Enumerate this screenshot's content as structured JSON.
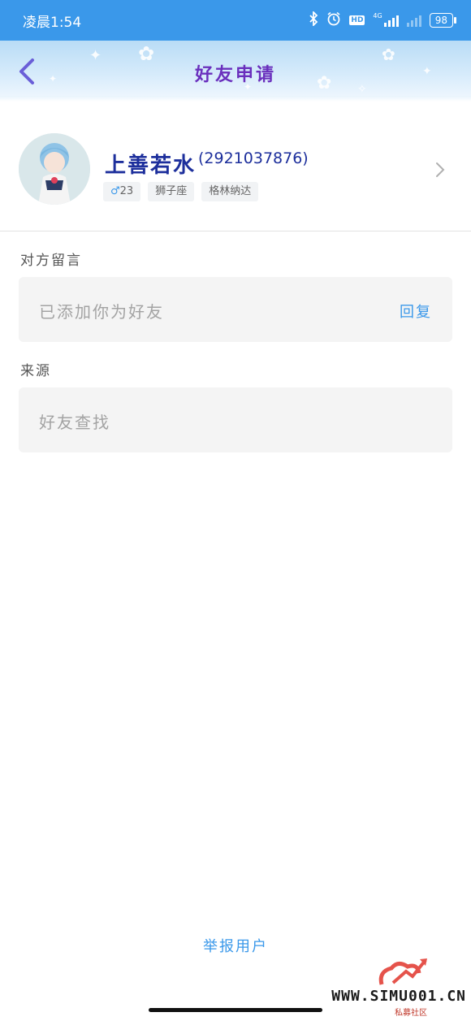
{
  "status_bar": {
    "time": "凌晨1:54",
    "hd": "HD",
    "network": "4G",
    "battery": "98"
  },
  "header": {
    "title": "好友申请"
  },
  "profile": {
    "nickname": "上善若水",
    "qq": "(2921037876)",
    "tags": {
      "gender_symbol": "♂",
      "age": "23",
      "zodiac": "狮子座",
      "location": "格林纳达"
    }
  },
  "message_section": {
    "label": "对方留言",
    "text": "已添加你为好友",
    "reply": "回复"
  },
  "source_section": {
    "label": "来源",
    "text": "好友查找"
  },
  "footer": {
    "report": "举报用户"
  },
  "watermark": {
    "text": "WWW.SIMU001.CN",
    "sub": "私募社区"
  },
  "colors": {
    "status_bar": "#3a98ea",
    "title": "#6a2fbd",
    "nickname": "#1d2f9c",
    "link": "#3a98ea"
  }
}
